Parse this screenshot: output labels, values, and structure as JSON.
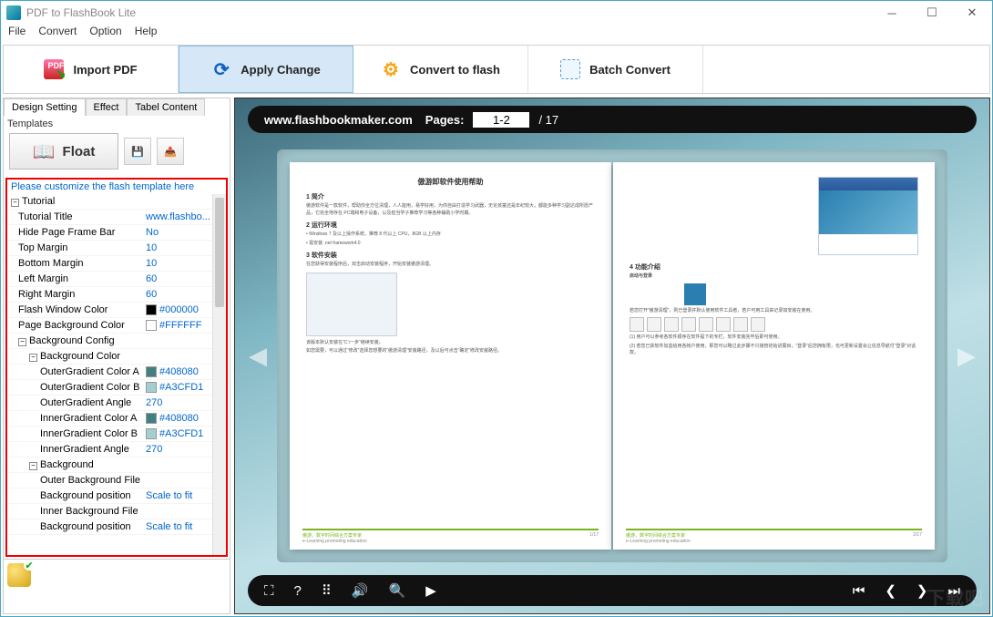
{
  "window": {
    "title": "PDF to FlashBook Lite"
  },
  "menu": {
    "file": "File",
    "convert": "Convert",
    "option": "Option",
    "help": "Help"
  },
  "toolbar": {
    "import": "Import PDF",
    "apply": "Apply Change",
    "toflash": "Convert to flash",
    "batch": "Batch Convert"
  },
  "tabs": {
    "design": "Design Setting",
    "effect": "Effect",
    "table": "Tabel Content"
  },
  "templates": {
    "label": "Templates",
    "float": "Float"
  },
  "customize_hdr": "Please customize the flash template here",
  "props": {
    "tutorial": "Tutorial",
    "tutorial_title_k": "Tutorial Title",
    "tutorial_title_v": "www.flashbo...",
    "hide_frame_k": "Hide Page Frame Bar",
    "hide_frame_v": "No",
    "top_margin_k": "Top Margin",
    "top_margin_v": "10",
    "bottom_margin_k": "Bottom Margin",
    "bottom_margin_v": "10",
    "left_margin_k": "Left Margin",
    "left_margin_v": "60",
    "right_margin_k": "Right Margin",
    "right_margin_v": "60",
    "flash_win_color_k": "Flash Window Color",
    "flash_win_color_v": "#000000",
    "page_bg_color_k": "Page Background Color",
    "page_bg_color_v": "#FFFFFF",
    "bg_config": "Background Config",
    "bg_color": "Background Color",
    "outer_a_k": "OuterGradient Color A",
    "outer_a_v": "#408080",
    "outer_b_k": "OuterGradient Color B",
    "outer_b_v": "#A3CFD1",
    "outer_ang_k": "OuterGradient Angle",
    "outer_ang_v": "270",
    "inner_a_k": "InnerGradient Color A",
    "inner_a_v": "#408080",
    "inner_b_k": "InnerGradient Color B",
    "inner_b_v": "#A3CFD1",
    "inner_ang_k": "InnerGradient Angle",
    "inner_ang_v": "270",
    "background": "Background",
    "outer_bgfile_k": "Outer Background File",
    "bg_pos_k": "Background position",
    "bg_pos_v": "Scale to fit",
    "inner_bgfile_k": "Inner Background File",
    "bg_pos2_k": "Background position",
    "bg_pos2_v": "Scale to fit"
  },
  "preview": {
    "url": "www.flashbookmaker.com",
    "pages_label": "Pages:",
    "page_current": "1-2",
    "page_sep": "/ 17"
  },
  "page1": {
    "title": "傲游卸软件使用帮助",
    "h1": "1  简介",
    "p1": "傲游软件是一款软件，帮助你全方位清理，人人能用，易学好用，为你自由打造学习武器，无论孩童还是年纪较大，都能多种学习副达成所愿产品，它完全地存在 PC端和电子设备，以及担当学子推荐学习等各种辅助小学时期。",
    "h2": "2  运行环境",
    "b1": "Windows 7 及以上操作系统，推荐 8 代以上 CPU，8GB 以上内存",
    "b2": "需安装 .net framework4.0",
    "h3": "3  软件安装",
    "p3": "在您获得安装程序后，双击启动安装程序，开始安装傲游清理。",
    "p4": "该版本默认安装在“C:\\一步”继续安装。",
    "p5": "如您需要，可以通过“修改”选择您想要的“傲游清理”安装路径，及以后可点击“确定”修改安装路径。",
    "foot1": "傲游，数字时间综合方案专家",
    "foot2": "e-Learning promoting education",
    "pg": "1/17"
  },
  "page2": {
    "h1": "4  功能介绍",
    "h2": "启动与登录",
    "p1": "若您打开“傲游清理”，则已登录并默认使用软件工具者，若户可用工具来记录如安装在使用。",
    "p2": "(1) 用户可以参考各软件顺序在软件提下的专栏，软件安装完毕后即可使用。",
    "p3": "(2) 若您已获软件加监给用各帐户使用，那您可以略过此步骤不只接管初始进展目，“登录”后您拥有限，也可更新设置会让信息导航付“登录”对话款。",
    "foot1": "傲游，数字时间综合方案专家",
    "foot2": "e-Learning promoting education",
    "pg": "2/17"
  },
  "colors": {
    "black": "#000000",
    "white": "#FFFFFF",
    "teal": "#408080",
    "ltteal": "#A3CFD1"
  }
}
